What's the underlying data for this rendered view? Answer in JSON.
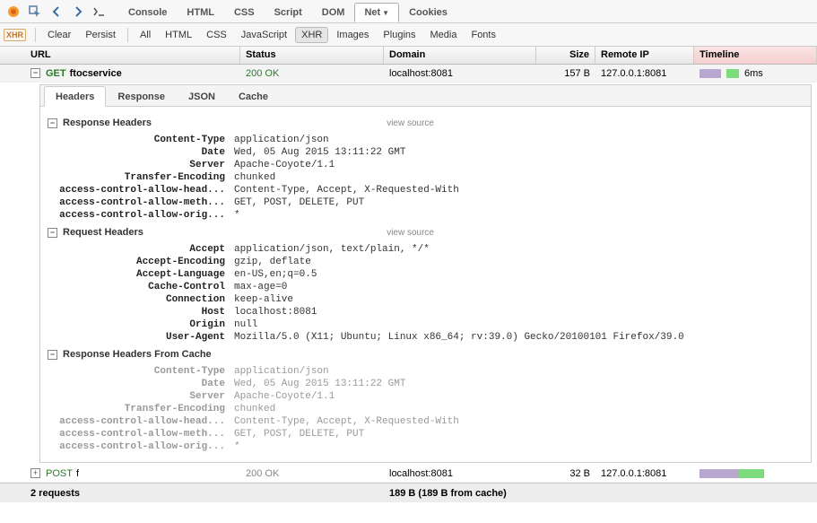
{
  "mainTabs": [
    "Console",
    "HTML",
    "CSS",
    "Script",
    "DOM",
    "Net",
    "Cookies"
  ],
  "mainTabActive": "Net",
  "filterBar": {
    "clear": "Clear",
    "persist": "Persist",
    "all": "All",
    "html": "HTML",
    "css": "CSS",
    "js": "JavaScript",
    "xhr": "XHR",
    "images": "Images",
    "plugins": "Plugins",
    "media": "Media",
    "fonts": "Fonts",
    "active": "XHR"
  },
  "columns": {
    "url": "URL",
    "status": "Status",
    "domain": "Domain",
    "size": "Size",
    "remote": "Remote IP",
    "timeline": "Timeline"
  },
  "requests": [
    {
      "method": "GET",
      "name": "ftocservice",
      "status": "200 OK",
      "domain": "localhost:8081",
      "size": "157 B",
      "remote": "127.0.0.1:8081",
      "time": "6ms",
      "expanded": true
    },
    {
      "method": "POST",
      "name": "f",
      "status": "200 OK",
      "domain": "localhost:8081",
      "size": "32 B",
      "remote": "127.0.0.1:8081",
      "time": "",
      "expanded": false
    }
  ],
  "subTabs": [
    "Headers",
    "Response",
    "JSON",
    "Cache"
  ],
  "subTabActive": "Headers",
  "sections": {
    "resp": {
      "title": "Response Headers",
      "vs": "view source"
    },
    "req": {
      "title": "Request Headers",
      "vs": "view source"
    },
    "cache": {
      "title": "Response Headers From Cache"
    }
  },
  "responseHeaders": [
    {
      "k": "Content-Type",
      "v": "application/json"
    },
    {
      "k": "Date",
      "v": "Wed, 05 Aug 2015 13:11:22 GMT"
    },
    {
      "k": "Server",
      "v": "Apache-Coyote/1.1"
    },
    {
      "k": "Transfer-Encoding",
      "v": "chunked"
    },
    {
      "k": "access-control-allow-head...",
      "v": "Content-Type, Accept, X-Requested-With"
    },
    {
      "k": "access-control-allow-meth...",
      "v": "GET, POST, DELETE, PUT"
    },
    {
      "k": "access-control-allow-orig...",
      "v": "*"
    }
  ],
  "requestHeaders": [
    {
      "k": "Accept",
      "v": "application/json, text/plain, */*"
    },
    {
      "k": "Accept-Encoding",
      "v": "gzip, deflate"
    },
    {
      "k": "Accept-Language",
      "v": "en-US,en;q=0.5"
    },
    {
      "k": "Cache-Control",
      "v": "max-age=0"
    },
    {
      "k": "Connection",
      "v": "keep-alive"
    },
    {
      "k": "Host",
      "v": "localhost:8081"
    },
    {
      "k": "Origin",
      "v": "null"
    },
    {
      "k": "User-Agent",
      "v": "Mozilla/5.0 (X11; Ubuntu; Linux x86_64; rv:39.0) Gecko/20100101 Firefox/39.0"
    }
  ],
  "cacheHeaders": [
    {
      "k": "Content-Type",
      "v": "application/json"
    },
    {
      "k": "Date",
      "v": "Wed, 05 Aug 2015 13:11:22 GMT"
    },
    {
      "k": "Server",
      "v": "Apache-Coyote/1.1"
    },
    {
      "k": "Transfer-Encoding",
      "v": "chunked"
    },
    {
      "k": "access-control-allow-head...",
      "v": "Content-Type, Accept, X-Requested-With"
    },
    {
      "k": "access-control-allow-meth...",
      "v": "GET, POST, DELETE, PUT"
    },
    {
      "k": "access-control-allow-orig...",
      "v": "*"
    }
  ],
  "footer": {
    "count": "2 requests",
    "size": "189 B  (189 B from cache)"
  }
}
